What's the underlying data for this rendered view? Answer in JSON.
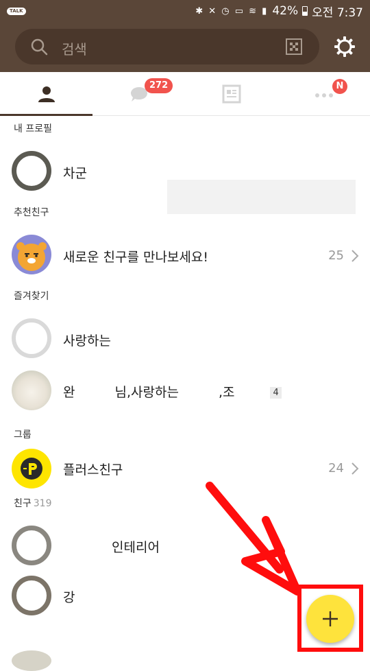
{
  "status_bar": {
    "app_badge": "TALK",
    "battery": "42%",
    "time": "오전 7:37"
  },
  "search": {
    "placeholder": "검색"
  },
  "tabs": [
    {
      "name": "friends",
      "icon": "person-icon",
      "active": true
    },
    {
      "name": "chats",
      "icon": "chat-bubble-icon",
      "badge": "272"
    },
    {
      "name": "channel",
      "icon": "news-icon"
    },
    {
      "name": "more",
      "icon": "more-dots-icon",
      "badge": "N"
    }
  ],
  "sections": {
    "my_profile": {
      "header": "내 프로필",
      "name": "차군"
    },
    "recommended": {
      "header": "추천친구",
      "name": "새로운 친구를 만나보세요!",
      "count": "25"
    },
    "favorites": {
      "header": "즐겨찾기",
      "items": [
        {
          "name": "사랑하는"
        },
        {
          "name_part1": "완",
          "name_part2": "님,사랑하는",
          "name_part3": ",조",
          "member_count": "4"
        }
      ]
    },
    "groups": {
      "header": "그룹",
      "name": "플러스친구",
      "count": "24"
    },
    "friends": {
      "header": "친구",
      "count": "319",
      "items": [
        {
          "name": "인테리어"
        },
        {
          "name": "강"
        }
      ]
    }
  },
  "fab": {
    "icon": "plus-icon"
  },
  "colors": {
    "header_brown": "#5a4638",
    "search_bg": "#4a372b",
    "badge_red": "#f1534d",
    "kakao_yellow": "#fee33c",
    "annotation_red": "#ff0d0d"
  }
}
